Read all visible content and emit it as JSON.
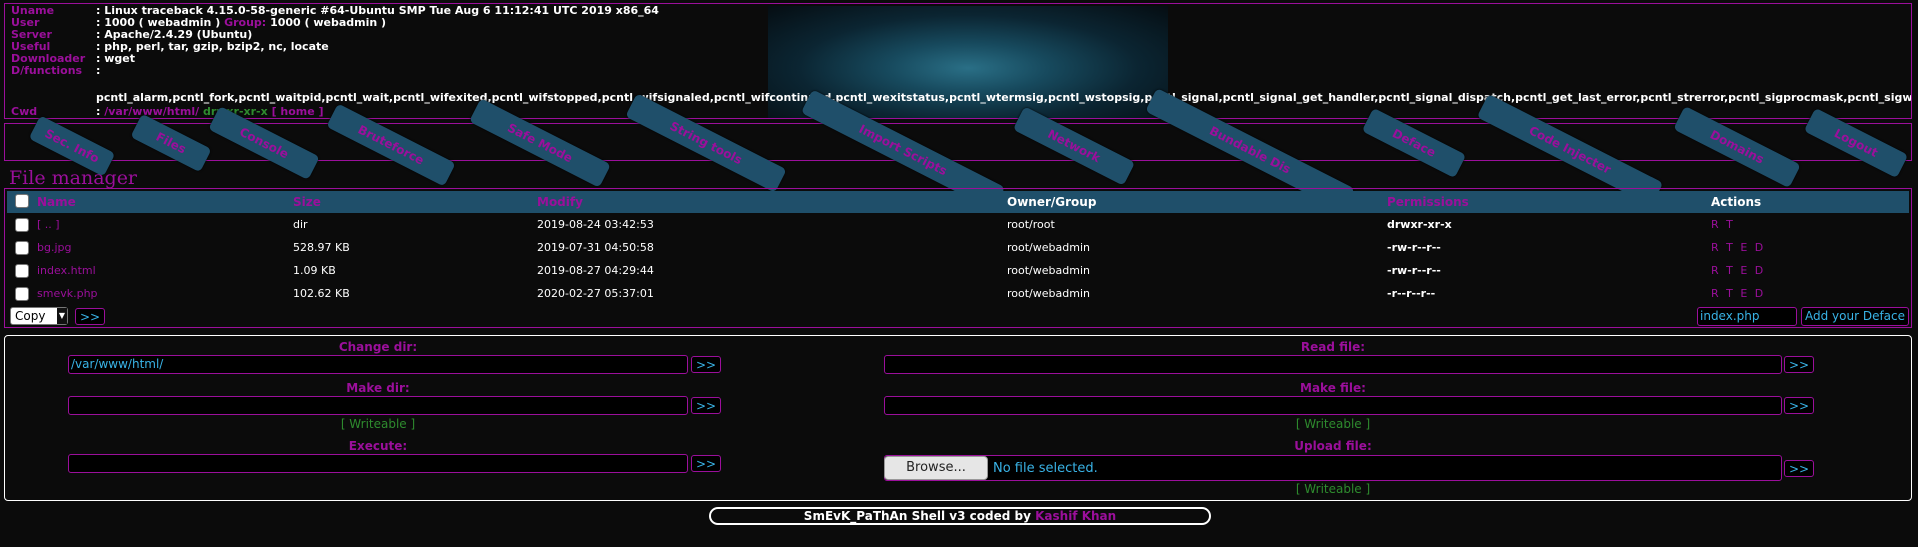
{
  "info": {
    "rows": [
      {
        "label": "Uname",
        "value": "Linux traceback 4.15.0-58-generic #64-Ubuntu SMP Tue Aug 6 11:12:41 UTC 2019 x86_64"
      },
      {
        "label": "User",
        "value_a": "1000 ( webadmin )",
        "group_label": "Group:",
        "value_b": "1000 ( webadmin )"
      },
      {
        "label": "Server",
        "value": "Apache/2.4.29 (Ubuntu)"
      },
      {
        "label": "Useful",
        "value": "php, perl, tar, gzip, bzip2, nc, locate"
      },
      {
        "label": "Downloader",
        "value": "wget"
      },
      {
        "label": "D/functions",
        "value": ":"
      }
    ],
    "disabled_functions": "pcntl_alarm,pcntl_fork,pcntl_waitpid,pcntl_wait,pcntl_wifexited,pcntl_wifstopped,pcntl_wifsignaled,pcntl_wifcontinued,pcntl_wexitstatus,pcntl_wtermsig,pcntl_wstopsig,pcntl_signal,pcntl_signal_get_handler,pcntl_signal_dispatch,pcntl_get_last_error,pcntl_strerror,pcntl_sigprocmask,pcntl_sigwaitinfo,pcntl_sigtimedwait",
    "cwd_label": "Cwd",
    "cwd_path": "/var/www/html/",
    "cwd_perms": "drwxr-xr-x",
    "cwd_home": "[ home ]"
  },
  "nav": {
    "tabs": [
      "Sec. Info",
      "Files",
      "Console",
      "Bruteforce",
      "Safe Mode",
      "String tools",
      "Import Scripts",
      "Network",
      "Bundable Dis",
      "Deface",
      "Code Injecter",
      "Domains",
      "Logout"
    ]
  },
  "file_manager": {
    "title": "File manager",
    "headers": {
      "name": "Name",
      "size": "Size",
      "modify": "Modify",
      "owner": "Owner/Group",
      "permissions": "Permissions",
      "actions": "Actions"
    },
    "rows": [
      {
        "name": "[ .. ]",
        "size": "dir",
        "modify": "2019-08-24 03:42:53",
        "owner": "root/root",
        "perms": "drwxr-xr-x",
        "actions": "R T"
      },
      {
        "name": "bg.jpg",
        "size": "528.97 KB",
        "modify": "2019-07-31 04:50:58",
        "owner": "root/webadmin",
        "perms": "-rw-r--r--",
        "actions": "R T E D"
      },
      {
        "name": "index.html",
        "size": "1.09 KB",
        "modify": "2019-08-27 04:29:44",
        "owner": "root/webadmin",
        "perms": "-rw-r--r--",
        "actions": "R T E D"
      },
      {
        "name": "smevk.php",
        "size": "102.62 KB",
        "modify": "2020-02-27 05:37:01",
        "owner": "root/webadmin",
        "perms": "-r--r--r--",
        "actions": "R T E D"
      }
    ],
    "bulk_action": "Copy",
    "go": ">>",
    "deface_file": "index.php",
    "deface_button": "Add your Deface"
  },
  "tools": {
    "change_dir": {
      "label": "Change dir:",
      "value": "/var/www/html/",
      "go": ">>"
    },
    "make_dir": {
      "label": "Make dir:",
      "value": "",
      "go": ">>",
      "status": "[ Writeable ]"
    },
    "execute": {
      "label": "Execute:",
      "value": "",
      "go": ">>"
    },
    "read_file": {
      "label": "Read file:",
      "value": "",
      "go": ">>"
    },
    "make_file": {
      "label": "Make file:",
      "value": "",
      "go": ">>",
      "status": "[ Writeable ]"
    },
    "upload_file": {
      "label": "Upload file:",
      "browse": "Browse...",
      "no_file": "No file selected.",
      "go": ">>",
      "status": "[ Writeable ]"
    }
  },
  "footer": {
    "text": "SmEvK_PaThAn Shell v3 coded by",
    "author": "Kashif Khan"
  },
  "colors": {
    "accent": "#9b0f9b",
    "tab_bg": "#1f4f6a",
    "link": "#39b3e6",
    "ok": "#2e8b2e",
    "bg": "#0b0b0b"
  }
}
